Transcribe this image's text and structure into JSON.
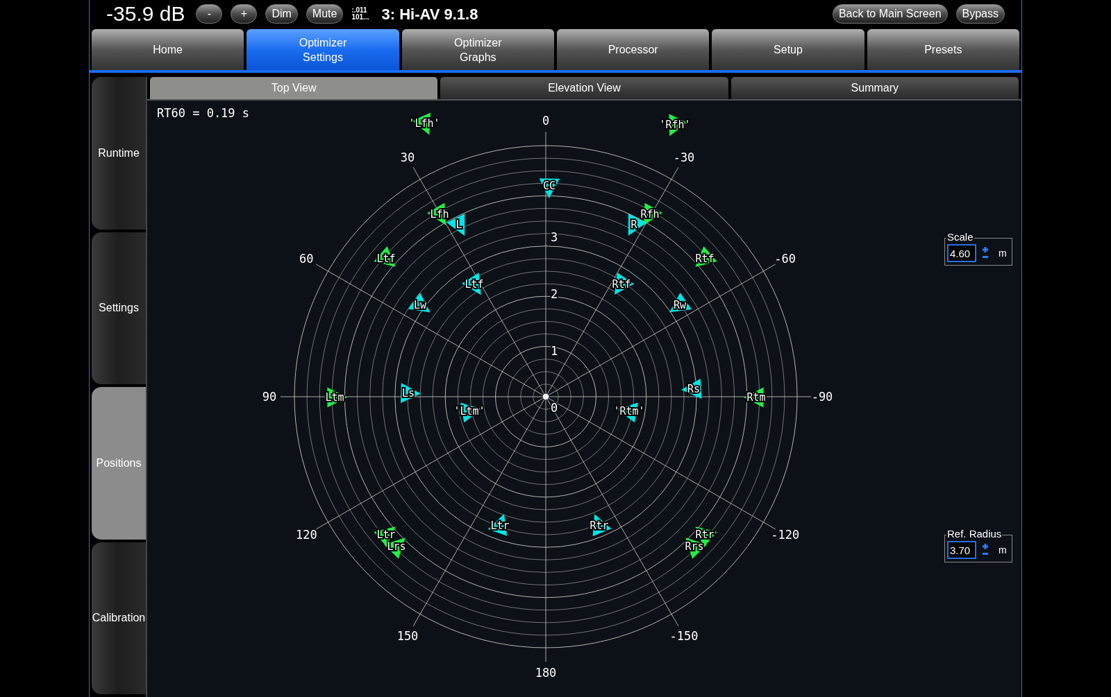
{
  "top_bar": {
    "volume": "-35.9 dB",
    "buttons": [
      "-",
      "+",
      "Dim",
      "Mute"
    ],
    "bitstream_text": [
      ":.011",
      "101..."
    ],
    "preset": "3: Hi-AV 9.1.8",
    "right_buttons": [
      "Back to Main Screen",
      "Bypass"
    ]
  },
  "tabs": [
    {
      "label": "Home",
      "selected": false
    },
    {
      "label": "Optimizer\nSettings",
      "selected": true
    },
    {
      "label": "Optimizer\nGraphs",
      "selected": false
    },
    {
      "label": "Processor",
      "selected": false
    },
    {
      "label": "Setup",
      "selected": false
    },
    {
      "label": "Presets",
      "selected": false
    }
  ],
  "sidebar": [
    {
      "label": "Runtime",
      "selected": false
    },
    {
      "label": "Settings",
      "selected": false
    },
    {
      "label": "Positions",
      "selected": true
    },
    {
      "label": "Calibration",
      "selected": false
    }
  ],
  "subtabs": [
    {
      "label": "Top View",
      "selected": true
    },
    {
      "label": "Elevation View",
      "selected": false
    },
    {
      "label": "Summary",
      "selected": false
    }
  ],
  "plot": {
    "rt60": "RT60 = 0.19 s",
    "angle_labels": [
      "0",
      "-30",
      "-60",
      "-90",
      "-120",
      "-150",
      "180",
      "150",
      "120",
      "90",
      "60",
      "30"
    ],
    "radius_labels": [
      "3",
      "2",
      "1",
      "0"
    ],
    "speakers": [
      {
        "label": "'Lfh'",
        "color": "#22ee44"
      },
      {
        "label": "'Rfh'",
        "color": "#22ee44"
      },
      {
        "label": "CC",
        "color": "#00e5e5"
      },
      {
        "label": "Lfh",
        "color": "#22ee44"
      },
      {
        "label": "L",
        "color": "#00e5e5"
      },
      {
        "label": "Rfh",
        "color": "#22ee44"
      },
      {
        "label": "R",
        "color": "#00e5e5"
      },
      {
        "label": "Ltf",
        "color": "#22ee44"
      },
      {
        "label": "Rtf",
        "color": "#22ee44"
      },
      {
        "label": "Ltf",
        "color": "#00e5e5"
      },
      {
        "label": "Rtf",
        "color": "#00e5e5"
      },
      {
        "label": "Lw",
        "color": "#00e5e5"
      },
      {
        "label": "Rw",
        "color": "#00e5e5"
      },
      {
        "label": "Ltm",
        "color": "#22ee44"
      },
      {
        "label": "Ls",
        "color": "#00e5e5"
      },
      {
        "label": "'Ltm'",
        "color": "#00e5e5"
      },
      {
        "label": "'Rtm'",
        "color": "#00e5e5"
      },
      {
        "label": "Rs",
        "color": "#00e5e5"
      },
      {
        "label": "Rtm",
        "color": "#22ee44"
      },
      {
        "label": "Ltr",
        "color": "#22ee44"
      },
      {
        "label": "Lrs",
        "color": "#22ee44"
      },
      {
        "label": "Ltr",
        "color": "#00e5e5"
      },
      {
        "label": "Rtr",
        "color": "#00e5e5"
      },
      {
        "label": "Rtr",
        "color": "#22ee44"
      },
      {
        "label": "Rrs",
        "color": "#22ee44"
      }
    ]
  },
  "fields": [
    {
      "label": "Scale",
      "value": "4.60",
      "unit": "m"
    },
    {
      "label": "Ref. Radius",
      "value": "3.70",
      "unit": "m"
    }
  ]
}
